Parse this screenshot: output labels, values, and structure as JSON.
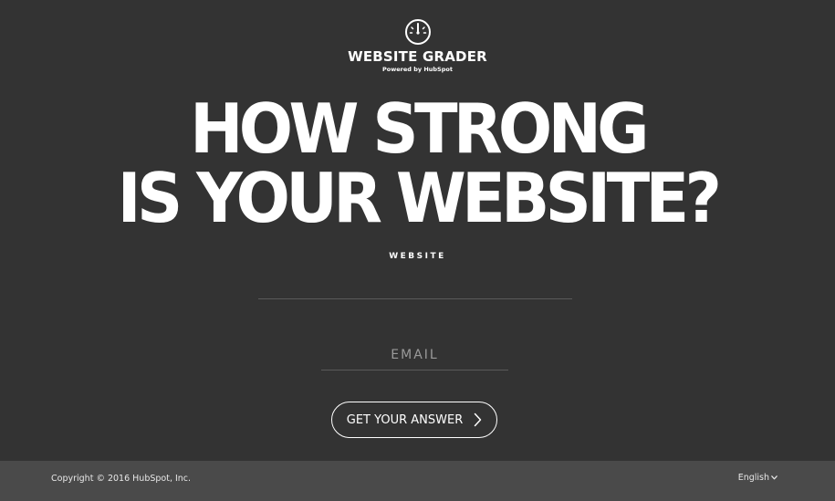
{
  "brand": {
    "name": "WEBSITE GRADER",
    "powered_by": "Powered by HubSpot",
    "logo_icon": "gauge-icon"
  },
  "headline": {
    "line1": "HOW STRONG",
    "line2": "IS YOUR WEBSITE?"
  },
  "form": {
    "website_label": "WEBSITE",
    "website_value": "",
    "email_placeholder": "EMAIL",
    "email_value": "",
    "submit_label": "GET YOUR ANSWER",
    "submit_icon": "chevron-right-icon"
  },
  "footer": {
    "copyright": "Copyright © 2016 HubSpot, Inc.",
    "language": "English",
    "language_icon": "chevron-down-icon"
  },
  "colors": {
    "background": "#333333",
    "footer_background": "#4a4a4a",
    "text": "#ffffff"
  }
}
